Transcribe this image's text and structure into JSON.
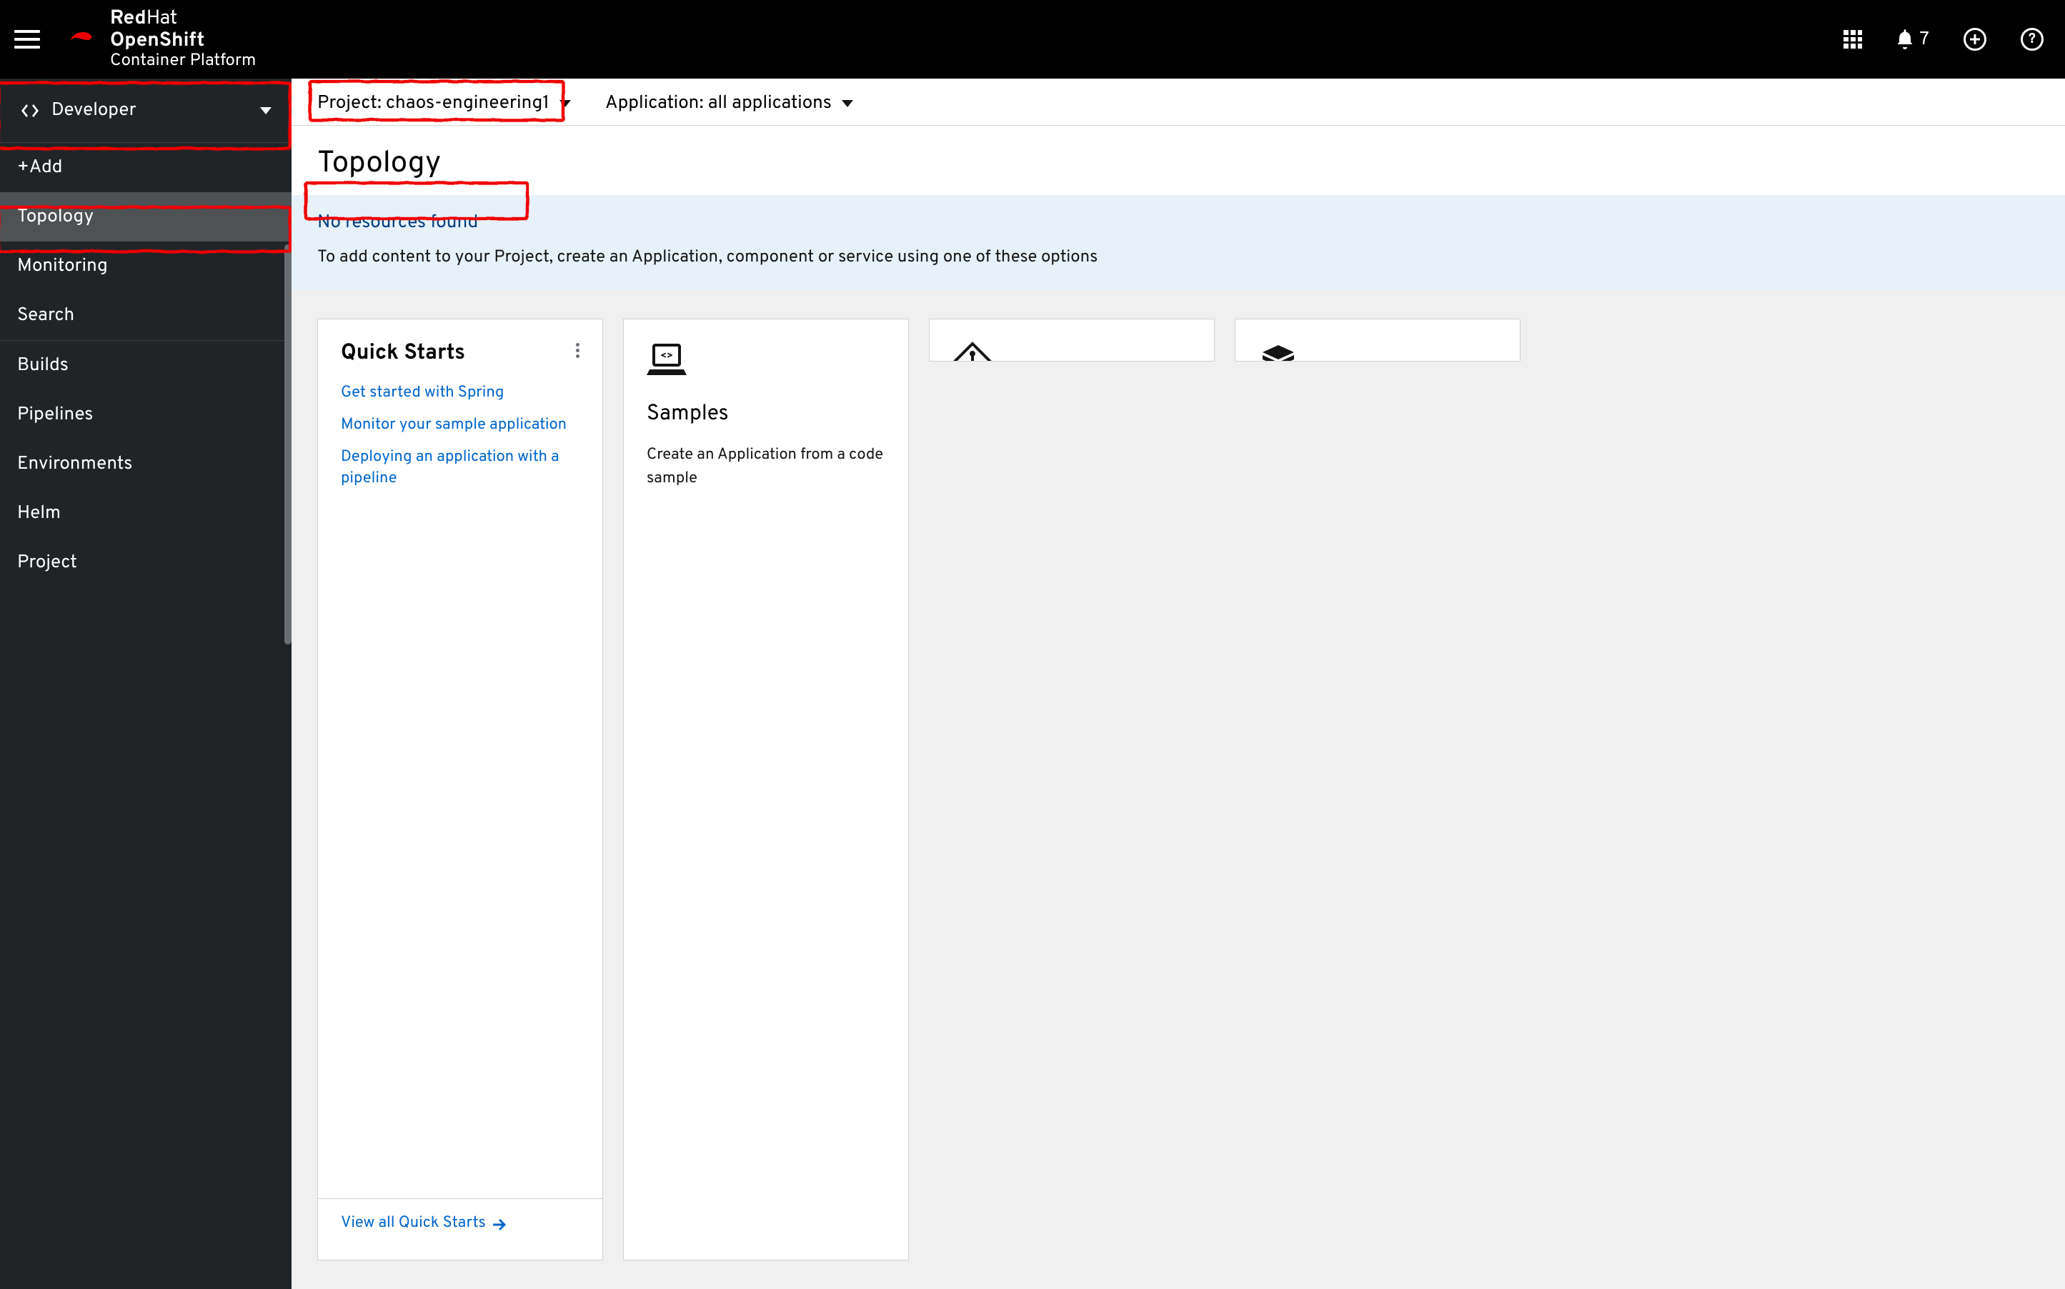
{
  "header": {
    "brand": {
      "line1_bold": "Red",
      "line1_thin": "Hat",
      "line2_bold": "OpenShift",
      "line3": "Container Platform"
    },
    "notification_count": "7"
  },
  "sidebar": {
    "perspective": "Developer",
    "items": [
      {
        "label": "+Add"
      },
      {
        "label": "Topology",
        "active": true
      },
      {
        "label": "Monitoring"
      },
      {
        "label": "Search",
        "divider_after": true
      },
      {
        "label": "Builds"
      },
      {
        "label": "Pipelines"
      },
      {
        "label": "Environments"
      },
      {
        "label": "Helm"
      },
      {
        "label": "Project"
      }
    ]
  },
  "main": {
    "project_selector": {
      "prefix": "Project:",
      "value": "chaos-engineering1"
    },
    "application_selector": {
      "prefix": "Application:",
      "value": "all applications"
    },
    "page_title": "Topology",
    "empty_state": {
      "title": "No resources found",
      "subtitle": "To add content to your Project, create an Application, component or service using one of these options"
    },
    "cards": {
      "quick_starts": {
        "title": "Quick Starts",
        "links": [
          "Get started with Spring",
          "Monitor your sample application",
          "Deploying an application with a pipeline"
        ],
        "footer": "View all Quick Starts"
      },
      "samples": {
        "title": "Samples",
        "desc": "Create an Application from a code sample"
      }
    }
  }
}
